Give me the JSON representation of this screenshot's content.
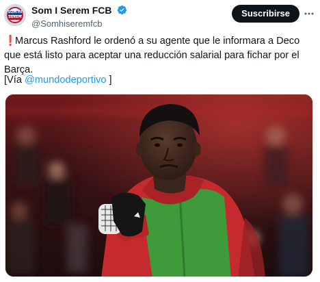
{
  "account": {
    "display_name": "Som I Serem FCB",
    "handle": "@Somhiseremfcb",
    "verified": true,
    "avatar_text_line1": "SOM-HI",
    "avatar_text_line2": "SEREM"
  },
  "actions": {
    "subscribe_label": "Suscribirse",
    "more_icon": "more-options-icon"
  },
  "tweet": {
    "alert_icon": "❗",
    "text_part1": " Marcus Rashford le ordenó a su agente que le informara a Deco que está listo para aceptar una reducción salarial para fichar por el Barça.",
    "via_prefix": "[Vía ",
    "via_mention": "@mundodeportivo",
    "via_suffix": " ]"
  },
  "colors": {
    "accent": "#1d9bf0",
    "text": "#0f1419",
    "muted": "#536471",
    "alert": "#e0245e"
  },
  "media": {
    "icon": "photo-of-football-player"
  }
}
